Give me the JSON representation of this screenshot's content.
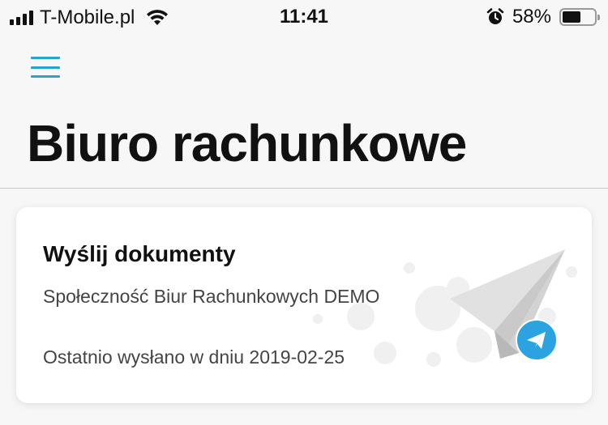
{
  "status_bar": {
    "carrier": "T-Mobile.pl",
    "time": "11:41",
    "battery_percent": "58%",
    "battery_level": 0.58
  },
  "header": {
    "menu_icon": "hamburger-menu-icon",
    "title": "Biuro rachunkowe",
    "accent_color": "#27a5c9"
  },
  "card": {
    "title": "Wyślij dokumenty",
    "subtitle": "Społeczność Biur Rachunkowych DEMO",
    "last_sent": "Ostatnio wysłano w dniu 2019-02-25",
    "illustration_icon": "paper-plane-icon",
    "badge_icon": "send-icon",
    "badge_color": "#2aa3e0"
  }
}
